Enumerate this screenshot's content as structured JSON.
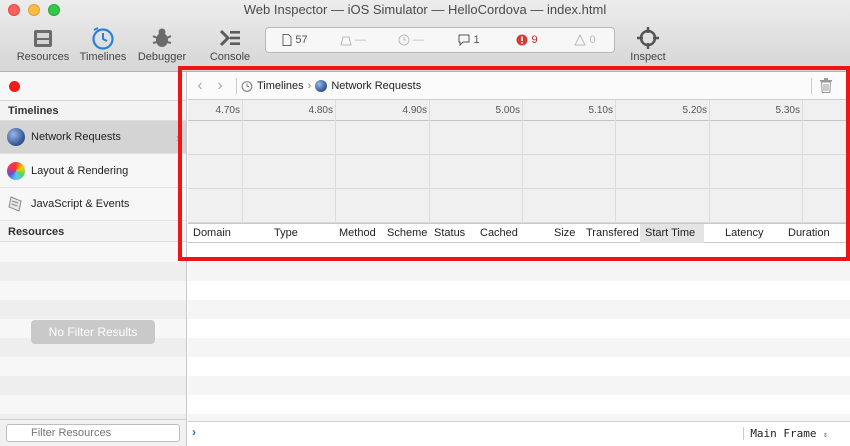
{
  "window": {
    "title": "Web Inspector — iOS Simulator — HelloCordova — index.html"
  },
  "toolbar": {
    "resources_label": "Resources",
    "timelines_label": "Timelines",
    "debugger_label": "Debugger",
    "console_label": "Console",
    "inspect_label": "Inspect"
  },
  "dashboard": {
    "resources_count": "57",
    "load_time": "—",
    "elapsed": "—",
    "logs": "1",
    "errors": "9",
    "warnings": "0"
  },
  "sidebar": {
    "timelines_header": "Timelines",
    "items": [
      {
        "label": "Network Requests"
      },
      {
        "label": "Layout & Rendering"
      },
      {
        "label": "JavaScript & Events"
      }
    ],
    "resources_header": "Resources",
    "no_filter": "No Filter Results",
    "filter_placeholder": "Filter Resources"
  },
  "breadcrumb": {
    "root": "Timelines",
    "current": "Network Requests"
  },
  "ruler": {
    "ticks": [
      "4.70s",
      "4.80s",
      "4.90s",
      "5.00s",
      "5.10s",
      "5.20s",
      "5.30s"
    ]
  },
  "columns": {
    "domain": "Domain",
    "type": "Type",
    "method": "Method",
    "scheme": "Scheme",
    "status": "Status",
    "cached": "Cached",
    "size": "Size",
    "transfered": "Transfered",
    "start_time": "Start Time",
    "latency": "Latency",
    "duration": "Duration"
  },
  "console": {
    "prompt": "›",
    "frame": "Main Frame"
  },
  "colors": {
    "highlight": "#f01414",
    "record": "#ef1c1c",
    "error": "#c02a2a"
  }
}
